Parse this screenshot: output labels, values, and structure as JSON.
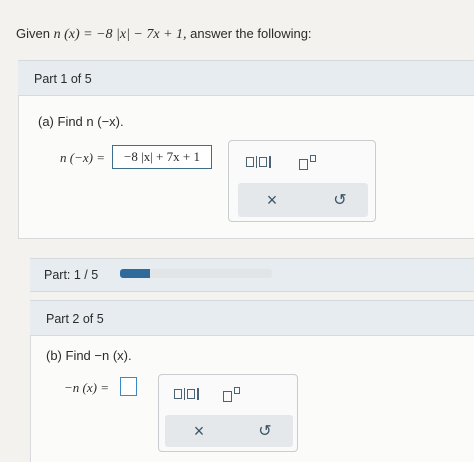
{
  "header": {
    "given_prefix": "Given ",
    "given_formula": "n (x) = −8 |x| − 7x + 1,",
    "given_suffix": " answer the following:"
  },
  "part1": {
    "label": "Part 1 of 5",
    "question": "(a) Find n (−x).",
    "answer_lhs": "n (−x) =",
    "answer_value": "−8 |x| + 7x + 1"
  },
  "progress": {
    "label": "Part: 1 / 5",
    "fraction": 0.2
  },
  "part2": {
    "label": "Part 2 of 5",
    "question": "(b) Find −n (x).",
    "answer_lhs": "−n (x) =",
    "answer_value": ""
  },
  "tools": {
    "x_label": "×",
    "undo_label": "↺"
  },
  "colors": {
    "accent": "#2f6a9c",
    "box_border": "#3d6e8c"
  }
}
